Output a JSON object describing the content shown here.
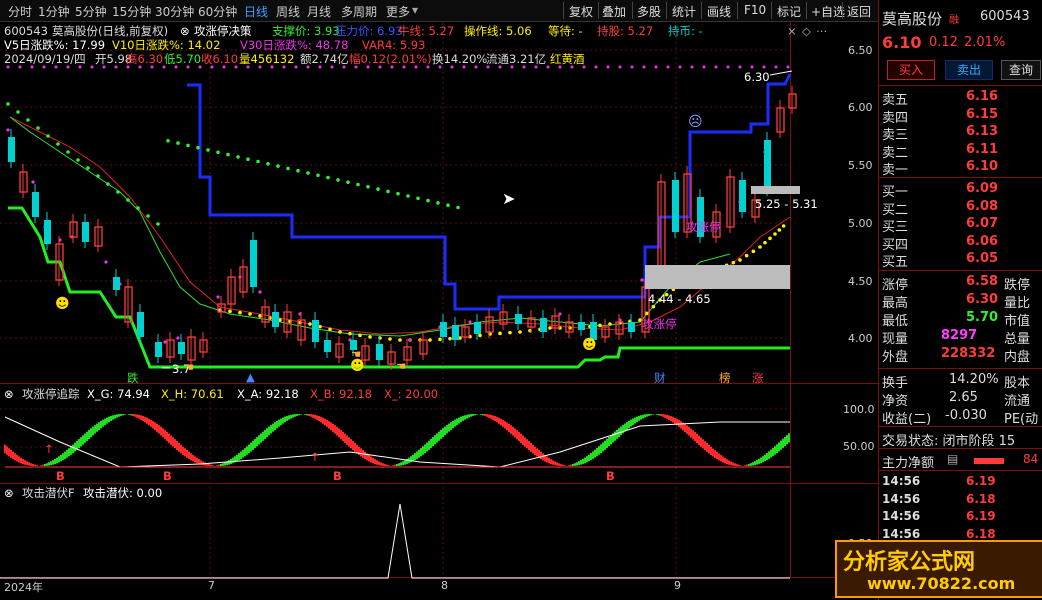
{
  "toolbar": {
    "periods": [
      "分时",
      "1分钟",
      "5分钟",
      "15分钟",
      "30分钟",
      "60分钟",
      "日线",
      "周线",
      "月线",
      "多周期",
      "更多"
    ],
    "active": "日线",
    "right": [
      "复权",
      "叠加",
      "多股",
      "统计",
      "画线",
      "F10",
      "标记",
      "+自选",
      "返回"
    ]
  },
  "chart_header": {
    "code": "600543",
    "name_info": "莫高股份(日线,前复权)",
    "indicator_name": "攻涨停决策",
    "support_label": "支撑价: 3.93",
    "pressure_label": "压力价: 6.93",
    "niuxian_label": "牛线: 5.27",
    "op_label": "操作线: 5.06",
    "wait_label": "等待: -",
    "hold_label": "持股: 5.27",
    "hold_coin": "持币: -",
    "row2": [
      "V5日涨跌%: 17.99",
      "V10日涨跌%: 14.02",
      "V30日涨跌%: 48.78",
      "VAR4: 5.93"
    ],
    "row3_date": "2024/09/19/四",
    "row3_open": "开5.98",
    "row3_high": "高6.30",
    "row3_low": "低5.70",
    "row3_close": "收6.10",
    "row3_vol": "量456132",
    "row3_amt": "额2.74亿",
    "row3_pct": "幅0.12(2.01%)",
    "row3_turn": "换14.20%",
    "row3_float": "流通3.21亿",
    "row3_sector": "红黄酒"
  },
  "price_axis": [
    "6.50",
    "6.00",
    "5.50",
    "5.00",
    "4.50",
    "4.00"
  ],
  "annotations": {
    "high_label": "6.30",
    "range1": "5.25 - 5.31",
    "range2": "4.44 - 4.65",
    "low_label": "3.7",
    "gongzhangting1": "攻涨停",
    "gongzhangting2": "攻涨停",
    "die": "跌",
    "cai": "财",
    "bang": "榜",
    "zhang": "涨"
  },
  "sub1": {
    "title": "攻涨停追踪",
    "xg": "X_G: 74.94",
    "xh": "X_H: 70.61",
    "xa": "X_A: 92.18",
    "xb": "X_B: 92.18",
    "x_": "X_: 20.00",
    "axis": [
      "100.0",
      "50.00"
    ],
    "b_marks": [
      "B",
      "B",
      "B",
      "B"
    ]
  },
  "sub2": {
    "title": "攻击潜伏F",
    "value": "攻击潜伏: 0.00",
    "axis": [
      "0.50"
    ]
  },
  "date_axis": [
    "2024年",
    "7",
    "8",
    "9"
  ],
  "panel": {
    "name": "莫高股份",
    "tag": "融",
    "code": "600543",
    "price": "6.10",
    "change": "0.12",
    "pct": "2.01%",
    "buy_btn": "买入",
    "sell_btn": "卖出",
    "query_btn": "查询",
    "sell_levels": [
      {
        "label": "卖五",
        "price": "6.16"
      },
      {
        "label": "卖四",
        "price": "6.15"
      },
      {
        "label": "卖三",
        "price": "6.13"
      },
      {
        "label": "卖二",
        "price": "6.11"
      },
      {
        "label": "卖一",
        "price": "6.10"
      }
    ],
    "buy_levels": [
      {
        "label": "买一",
        "price": "6.09"
      },
      {
        "label": "买二",
        "price": "6.08"
      },
      {
        "label": "买三",
        "price": "6.07"
      },
      {
        "label": "买四",
        "price": "6.06"
      },
      {
        "label": "买五",
        "price": "6.05"
      }
    ],
    "stats": [
      {
        "l": "涨停",
        "v": "6.58",
        "r": "跌停"
      },
      {
        "l": "最高",
        "v": "6.30",
        "r": "量比"
      },
      {
        "l": "最低",
        "v": "5.70",
        "r": "市值"
      },
      {
        "l": "现量",
        "v": "8297",
        "r": "总量"
      },
      {
        "l": "外盘",
        "v": "228332",
        "r": "内盘"
      }
    ],
    "stats2": [
      {
        "l": "换手",
        "v": "14.20%",
        "r": "股本"
      },
      {
        "l": "净资",
        "v": "2.65",
        "r": "流通"
      },
      {
        "l": "收益(二)",
        "v": "-0.030",
        "r": "PE(动"
      }
    ],
    "trade_status": "交易状态: 闭市阶段 15",
    "main_net": "主力净额",
    "main_net_val": "84",
    "ticks": [
      {
        "t": "14:56",
        "p": "6.19"
      },
      {
        "t": "14:56",
        "p": "6.18"
      },
      {
        "t": "14:56",
        "p": "6.19"
      },
      {
        "t": "14:56",
        "p": "6.18"
      },
      {
        "t": "14:56",
        "p": "6.18"
      }
    ]
  },
  "watermark": {
    "line1": "分析家公式网",
    "line2": "www.70822.com"
  },
  "colors": {
    "red": "#ff3c3c",
    "green": "#00e000",
    "blue": "#1c2cff",
    "cyan": "#00d0d0",
    "yellow": "#ffff00",
    "magenta": "#ff40ff"
  }
}
